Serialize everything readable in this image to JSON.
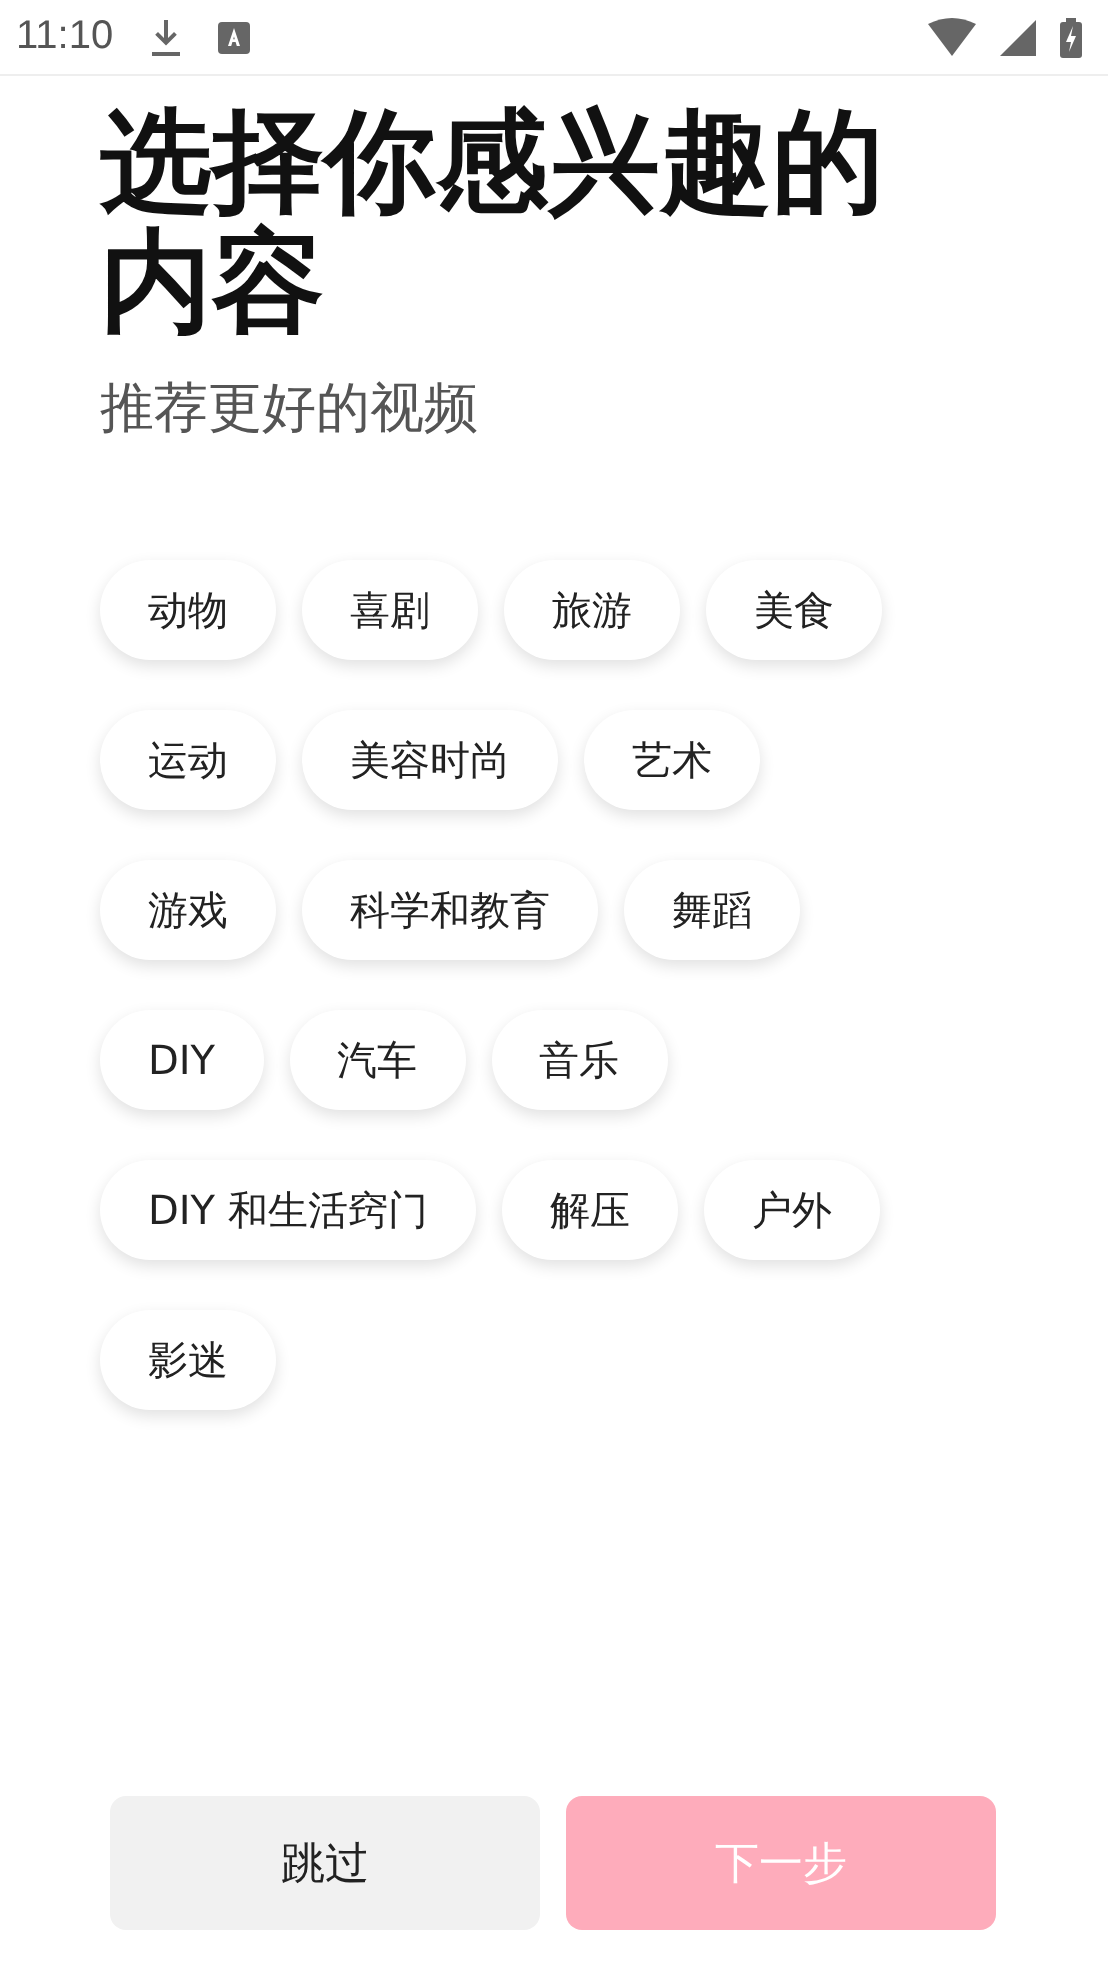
{
  "status_bar": {
    "time": "11:10"
  },
  "title": "选择你感兴趣的内容",
  "subtitle": "推荐更好的视频",
  "topics": [
    {
      "label": "动物",
      "selected": false
    },
    {
      "label": "喜剧",
      "selected": false
    },
    {
      "label": "旅游",
      "selected": false
    },
    {
      "label": "美食",
      "selected": false
    },
    {
      "label": "运动",
      "selected": false
    },
    {
      "label": "美容时尚",
      "selected": false
    },
    {
      "label": "艺术",
      "selected": false
    },
    {
      "label": "游戏",
      "selected": false
    },
    {
      "label": "科学和教育",
      "selected": false
    },
    {
      "label": "舞蹈",
      "selected": false
    },
    {
      "label": "DIY",
      "selected": false
    },
    {
      "label": "汽车",
      "selected": false
    },
    {
      "label": "音乐",
      "selected": false
    },
    {
      "label": "DIY 和生活窍门",
      "selected": false
    },
    {
      "label": "解压",
      "selected": false
    },
    {
      "label": "户外",
      "selected": false
    },
    {
      "label": "影迷",
      "selected": false
    }
  ],
  "buttons": {
    "skip": {
      "label": "跳过"
    },
    "next": {
      "label": "下一步",
      "disabled": true
    }
  }
}
